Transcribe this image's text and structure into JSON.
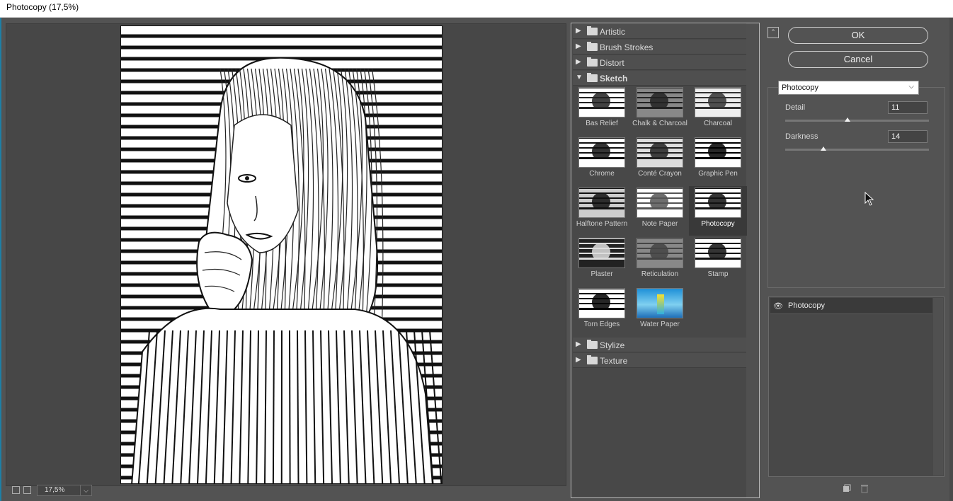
{
  "window": {
    "title": "Photocopy (17,5%)"
  },
  "preview": {
    "zoom": "17,5%"
  },
  "gallery": {
    "categories_top": [
      {
        "name": "Artistic",
        "arrow": "▶"
      },
      {
        "name": "Brush Strokes",
        "arrow": "▶"
      },
      {
        "name": "Distort",
        "arrow": "▶"
      },
      {
        "name": "Sketch",
        "arrow": "▼"
      }
    ],
    "sketch_filters": [
      "Bas Relief",
      "Chalk & Charcoal",
      "Charcoal",
      "Chrome",
      "Conté Crayon",
      "Graphic Pen",
      "Halftone Pattern",
      "Note Paper",
      "Photocopy",
      "Plaster",
      "Reticulation",
      "Stamp",
      "Torn Edges",
      "Water Paper"
    ],
    "selected_filter": "Photocopy",
    "categories_bottom": [
      {
        "name": "Stylize",
        "arrow": "▶"
      },
      {
        "name": "Texture",
        "arrow": "▶"
      }
    ]
  },
  "buttons": {
    "ok": "OK",
    "cancel": "Cancel"
  },
  "settings": {
    "filter": "Photocopy",
    "detail": {
      "label": "Detail",
      "value": "11",
      "min": 1,
      "max": 24
    },
    "darkness": {
      "label": "Darkness",
      "value": "14",
      "min": 1,
      "max": 50
    }
  },
  "layers": {
    "items": [
      {
        "name": "Photocopy",
        "visible": true
      }
    ]
  }
}
